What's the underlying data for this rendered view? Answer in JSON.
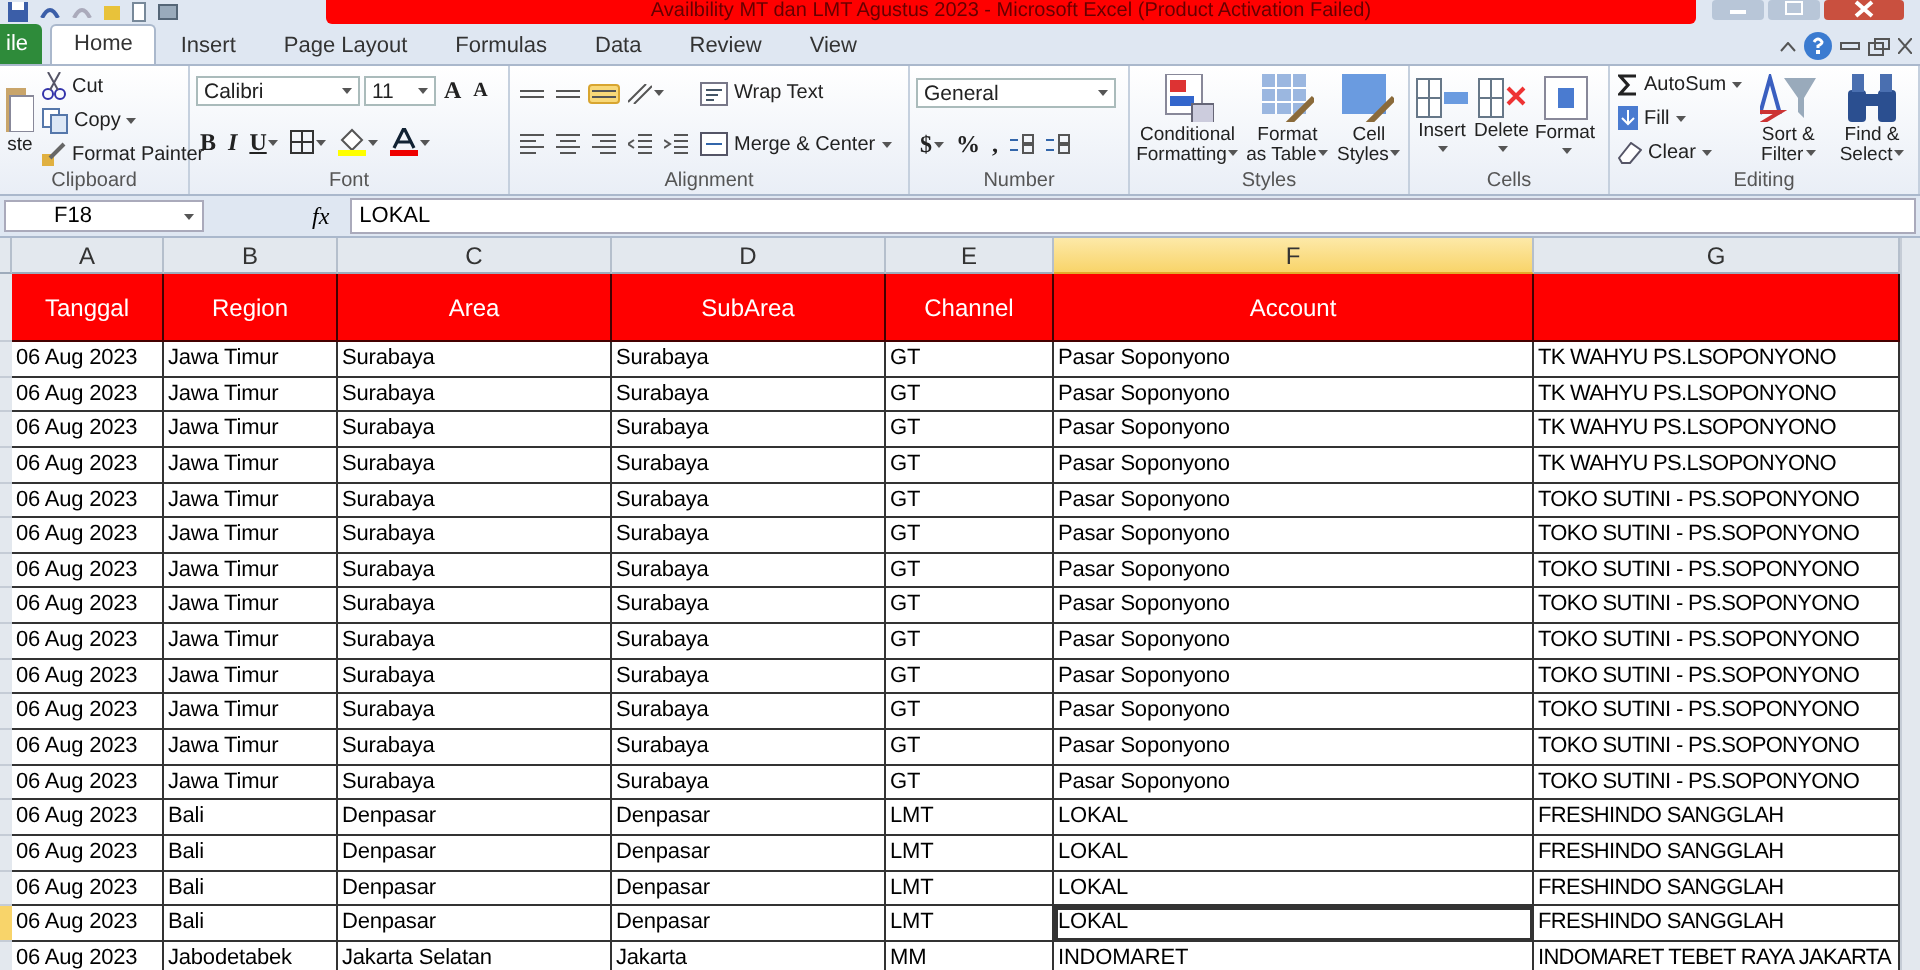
{
  "window": {
    "title": "Availbility MT dan LMT Agustus 2023  -  Microsoft Excel (Product Activation Failed)"
  },
  "tabs": [
    {
      "label": "ile",
      "kind": "file",
      "selected": false
    },
    {
      "label": "Home",
      "kind": "tab",
      "selected": true
    },
    {
      "label": "Insert",
      "kind": "tab",
      "selected": false
    },
    {
      "label": "Page Layout",
      "kind": "tab",
      "selected": false
    },
    {
      "label": "Formulas",
      "kind": "tab",
      "selected": false
    },
    {
      "label": "Data",
      "kind": "tab",
      "selected": false
    },
    {
      "label": "Review",
      "kind": "tab",
      "selected": false
    },
    {
      "label": "View",
      "kind": "tab",
      "selected": false
    }
  ],
  "ribbon": [
    {
      "label": "Clipboard",
      "columns": [
        [
          {
            "kind": "paste",
            "label": "ste"
          }
        ],
        [
          {
            "kind": "cut",
            "label": "Cut"
          },
          {
            "kind": "copy",
            "label": "Copy"
          },
          {
            "kind": "painter",
            "label": "Format Painter"
          }
        ]
      ]
    },
    {
      "label": "Font",
      "columns": [
        [
          [
            {
              "kind": "font-field",
              "label": "Calibri"
            },
            {
              "kind": "size-field",
              "label": "11"
            },
            {
              "kind": "grow",
              "label": "A"
            },
            {
              "kind": "shrink",
              "label": "A"
            }
          ],
          [
            {
              "kind": "bold",
              "label": "B"
            },
            {
              "kind": "italic",
              "label": "I"
            },
            {
              "kind": "underline",
              "label": "U"
            },
            {
              "kind": "borders",
              "on": false
            },
            {
              "kind": "fill-color",
              "on": false
            },
            {
              "kind": "font-color",
              "on": false
            }
          ]
        ]
      ]
    },
    {
      "label": "Alignment",
      "columns": [
        [
          [
            {
              "kind": "align-top",
              "on": false
            },
            {
              "kind": "align-middle",
              "on": false
            },
            {
              "kind": "align-bottom",
              "on": true
            },
            {
              "kind": "orientation",
              "on": false
            }
          ],
          [
            {
              "kind": "align-left",
              "on": false
            },
            {
              "kind": "align-center",
              "on": false
            },
            {
              "kind": "align-right",
              "on": false
            },
            {
              "kind": "outdent",
              "on": false
            },
            {
              "kind": "indent",
              "on": false
            }
          ]
        ],
        [
          {
            "kind": "wrap",
            "label": "Wrap Text"
          },
          {
            "kind": "merge",
            "label": "Merge & Center"
          }
        ]
      ]
    },
    {
      "label": "Number",
      "columns": [
        [
          [
            {
              "kind": "number-field",
              "label": "General"
            }
          ],
          [
            {
              "kind": "currency",
              "label": "$"
            },
            {
              "kind": "percent",
              "label": "%"
            },
            {
              "kind": "comma",
              "label": ","
            },
            {
              "kind": "more-decimal",
              "on": false
            },
            {
              "kind": "less-decimal",
              "on": false
            }
          ]
        ]
      ]
    },
    {
      "label": "Styles",
      "columns": [
        [
          {
            "kind": "conditional",
            "label": "Conditional Formatting"
          }
        ],
        [
          {
            "kind": "as-table",
            "label": "Format as Table"
          }
        ],
        [
          {
            "kind": "cell-styles",
            "label": "Cell Styles"
          }
        ]
      ]
    },
    {
      "label": "Cells",
      "columns": [
        [
          {
            "kind": "insert",
            "label": "Insert"
          }
        ],
        [
          {
            "kind": "delete",
            "label": "Delete"
          }
        ],
        [
          {
            "kind": "format",
            "label": "Format"
          }
        ]
      ]
    },
    {
      "label": "Editing",
      "columns": [
        [
          {
            "kind": "autosum",
            "label": "AutoSum"
          },
          {
            "kind": "fill",
            "label": "Fill"
          },
          {
            "kind": "clear",
            "label": "Clear"
          }
        ],
        [
          {
            "kind": "sort",
            "label": "Sort & Filter"
          }
        ],
        [
          {
            "kind": "find",
            "label": "Find & Select"
          }
        ]
      ]
    }
  ],
  "formula_bar": {
    "name_box": "F18",
    "fx": "fx",
    "formula": "LOKAL"
  },
  "sheet": {
    "columns": [
      {
        "letter": "A",
        "selected": false
      },
      {
        "letter": "B",
        "selected": false
      },
      {
        "letter": "C",
        "selected": false
      },
      {
        "letter": "D",
        "selected": false
      },
      {
        "letter": "E",
        "selected": false
      },
      {
        "letter": "F",
        "selected": true
      },
      {
        "letter": "G",
        "selected": false
      }
    ],
    "header": [
      "Tanggal",
      "Region",
      "Area",
      "SubArea",
      "Channel",
      "Account"
    ],
    "rows": [
      {
        "selected": false,
        "cells": [
          "06 Aug 2023",
          "Jawa Timur",
          "Surabaya",
          "Surabaya",
          "GT",
          "Pasar Soponyono",
          "TK WAHYU PS.LSOPONYONO"
        ]
      },
      {
        "selected": false,
        "cells": [
          "06 Aug 2023",
          "Jawa Timur",
          "Surabaya",
          "Surabaya",
          "GT",
          "Pasar Soponyono",
          "TK WAHYU PS.LSOPONYONO"
        ]
      },
      {
        "selected": false,
        "cells": [
          "06 Aug 2023",
          "Jawa Timur",
          "Surabaya",
          "Surabaya",
          "GT",
          "Pasar Soponyono",
          "TK WAHYU PS.LSOPONYONO"
        ]
      },
      {
        "selected": false,
        "cells": [
          "06 Aug 2023",
          "Jawa Timur",
          "Surabaya",
          "Surabaya",
          "GT",
          "Pasar Soponyono",
          "TK WAHYU PS.LSOPONYONO"
        ]
      },
      {
        "selected": false,
        "cells": [
          "06 Aug 2023",
          "Jawa Timur",
          "Surabaya",
          "Surabaya",
          "GT",
          "Pasar Soponyono",
          "TOKO SUTINI - PS.SOPONYONO"
        ]
      },
      {
        "selected": false,
        "cells": [
          "06 Aug 2023",
          "Jawa Timur",
          "Surabaya",
          "Surabaya",
          "GT",
          "Pasar Soponyono",
          "TOKO SUTINI - PS.SOPONYONO"
        ]
      },
      {
        "selected": false,
        "cells": [
          "06 Aug 2023",
          "Jawa Timur",
          "Surabaya",
          "Surabaya",
          "GT",
          "Pasar Soponyono",
          "TOKO SUTINI - PS.SOPONYONO"
        ]
      },
      {
        "selected": false,
        "cells": [
          "06 Aug 2023",
          "Jawa Timur",
          "Surabaya",
          "Surabaya",
          "GT",
          "Pasar Soponyono",
          "TOKO SUTINI - PS.SOPONYONO"
        ]
      },
      {
        "selected": false,
        "cells": [
          "06 Aug 2023",
          "Jawa Timur",
          "Surabaya",
          "Surabaya",
          "GT",
          "Pasar Soponyono",
          "TOKO SUTINI - PS.SOPONYONO"
        ]
      },
      {
        "selected": false,
        "cells": [
          "06 Aug 2023",
          "Jawa Timur",
          "Surabaya",
          "Surabaya",
          "GT",
          "Pasar Soponyono",
          "TOKO SUTINI - PS.SOPONYONO"
        ]
      },
      {
        "selected": false,
        "cells": [
          "06 Aug 2023",
          "Jawa Timur",
          "Surabaya",
          "Surabaya",
          "GT",
          "Pasar Soponyono",
          "TOKO SUTINI - PS.SOPONYONO"
        ]
      },
      {
        "selected": false,
        "cells": [
          "06 Aug 2023",
          "Jawa Timur",
          "Surabaya",
          "Surabaya",
          "GT",
          "Pasar Soponyono",
          "TOKO SUTINI - PS.SOPONYONO"
        ]
      },
      {
        "selected": false,
        "cells": [
          "06 Aug 2023",
          "Jawa Timur",
          "Surabaya",
          "Surabaya",
          "GT",
          "Pasar Soponyono",
          "TOKO SUTINI - PS.SOPONYONO"
        ]
      },
      {
        "selected": false,
        "cells": [
          "06 Aug 2023",
          "Bali",
          "Denpasar",
          "Denpasar",
          "LMT",
          "LOKAL",
          "FRESHINDO SANGGLAH"
        ]
      },
      {
        "selected": false,
        "cells": [
          "06 Aug 2023",
          "Bali",
          "Denpasar",
          "Denpasar",
          "LMT",
          "LOKAL",
          "FRESHINDO SANGGLAH"
        ]
      },
      {
        "selected": false,
        "cells": [
          "06 Aug 2023",
          "Bali",
          "Denpasar",
          "Denpasar",
          "LMT",
          "LOKAL",
          "FRESHINDO SANGGLAH"
        ]
      },
      {
        "selected": true,
        "cells": [
          "06 Aug 2023",
          "Bali",
          "Denpasar",
          "Denpasar",
          "LMT",
          "LOKAL",
          "FRESHINDO SANGGLAH"
        ]
      },
      {
        "selected": false,
        "cells": [
          "06 Aug 2023",
          "Jabodetabek",
          "Jakarta Selatan",
          "Jakarta",
          "MM",
          "INDOMARET",
          "INDOMARET TEBET RAYA JAKARTA"
        ]
      }
    ]
  }
}
